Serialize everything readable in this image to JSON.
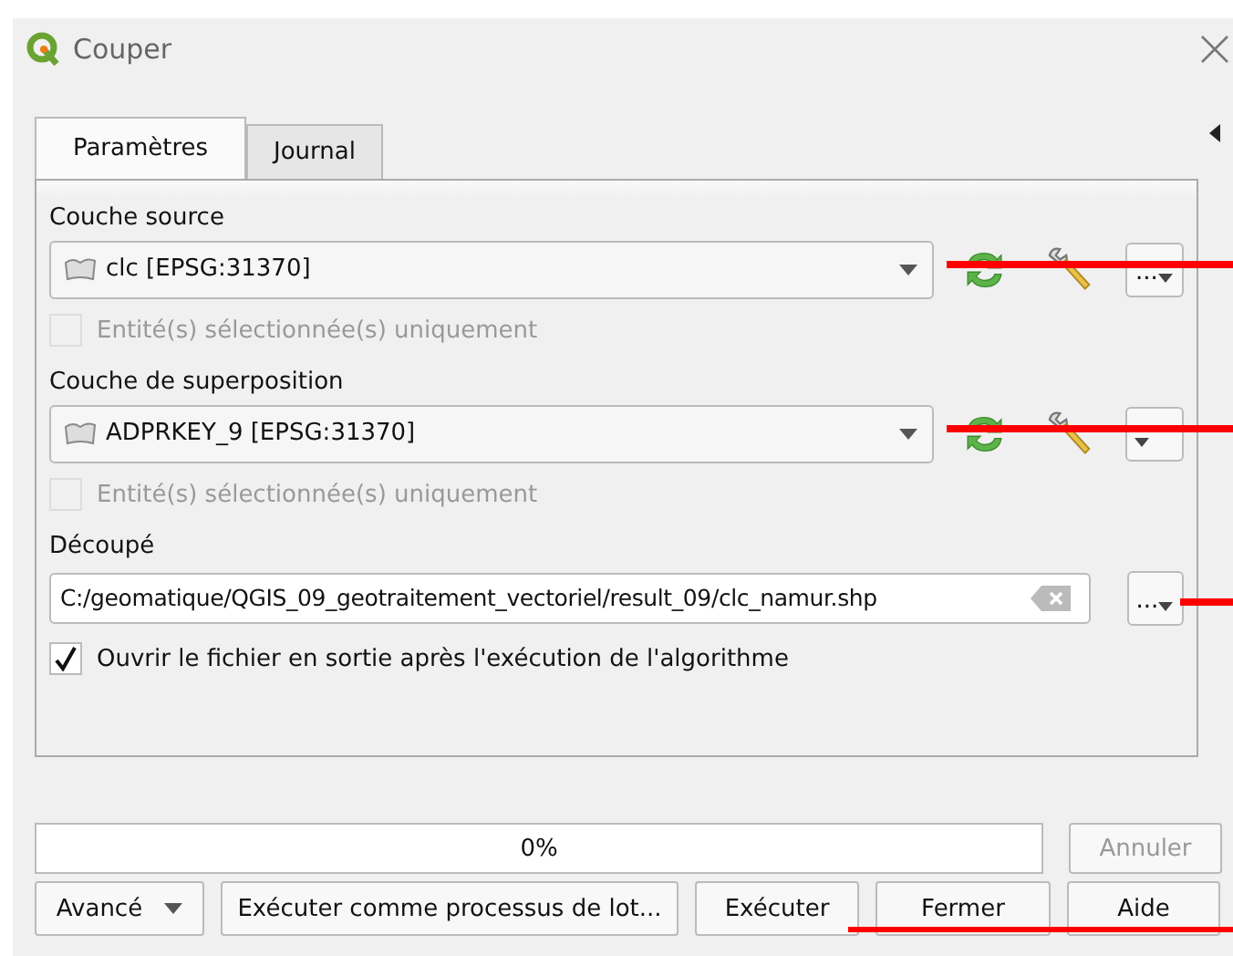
{
  "window": {
    "title": "Couper"
  },
  "tabs": [
    {
      "label": "Paramètres",
      "selected": true
    },
    {
      "label": "Journal",
      "selected": false
    }
  ],
  "parameters": [
    {
      "kind": "layer",
      "label": "Couche source",
      "value": "clc [EPSG:31370]",
      "more_button": "...",
      "marked": true,
      "option": {
        "label": "Entité(s) sélectionnée(s) uniquement",
        "checked": false,
        "disabled": true
      }
    },
    {
      "kind": "layer",
      "label": "Couche de superposition",
      "value": "ADPRKEY_9 [EPSG:31370]",
      "marked": true,
      "option": {
        "label": "Entité(s) sélectionnée(s) uniquement",
        "checked": false,
        "disabled": true
      }
    },
    {
      "kind": "file",
      "label": "Découpé",
      "value": "C:/geomatique/QGIS_09_geotraitement_vectoriel/result_09/clc_namur.shp",
      "more_button": "...",
      "marked": true,
      "option": {
        "label": "Ouvrir le fichier en sortie après l'exécution de l'algorithme",
        "checked": true,
        "disabled": false
      }
    }
  ],
  "progress": {
    "level": 0,
    "text": "0%"
  },
  "cancel_button": {
    "label": "Annuler",
    "disabled": true
  },
  "buttons": [
    {
      "kind": "menu",
      "label": "Avancé",
      "marked": false
    },
    {
      "kind": "plain",
      "label": "Exécuter comme processus de lot...",
      "marked": false
    },
    {
      "kind": "plain",
      "label": "Exécuter",
      "marked": true
    },
    {
      "kind": "plain",
      "label": "Fermer"
    },
    {
      "kind": "plain",
      "label": "Aide"
    }
  ]
}
